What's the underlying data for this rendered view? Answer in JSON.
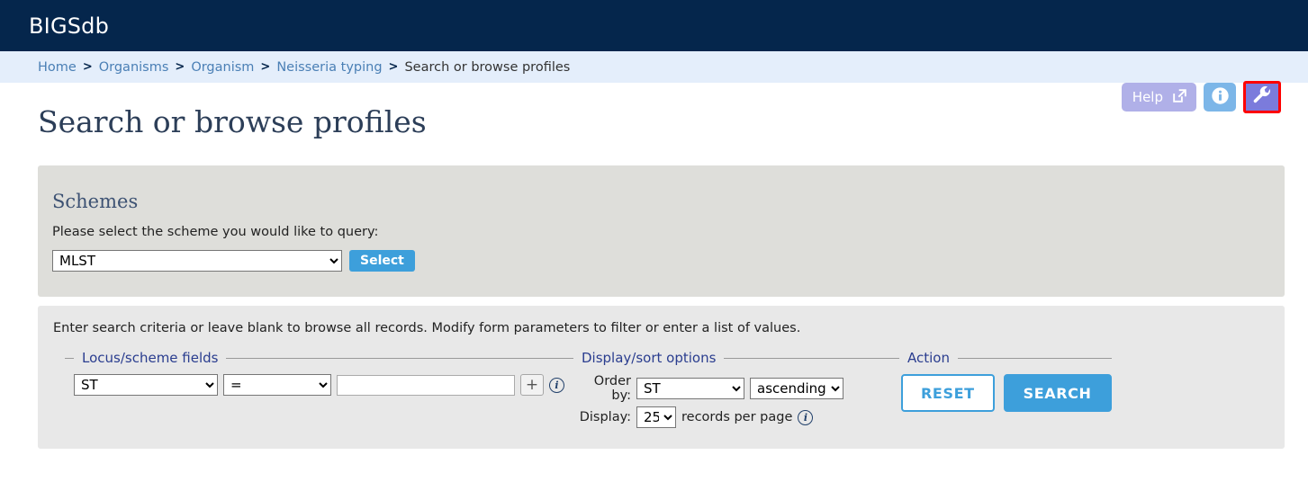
{
  "header": {
    "app_title": "BIGSdb"
  },
  "breadcrumb": {
    "items": [
      {
        "label": "Home",
        "current": false
      },
      {
        "label": "Organisms",
        "current": false
      },
      {
        "label": "Organism",
        "current": false
      },
      {
        "label": "Neisseria typing",
        "current": false
      },
      {
        "label": "Search or browse profiles",
        "current": true
      }
    ],
    "separator": ">"
  },
  "tools": {
    "help_label": "Help",
    "help_icon": "external-link-icon",
    "info_icon": "info-icon",
    "wrench_icon": "wrench-icon",
    "highlight_color": "#ff0000"
  },
  "page": {
    "title": "Search or browse profiles"
  },
  "schemes": {
    "heading": "Schemes",
    "prompt": "Please select the scheme you would like to query:",
    "selected_scheme": "MLST",
    "select_button": "Select"
  },
  "query": {
    "intro": "Enter search criteria or leave blank to browse all records. Modify form parameters to filter or enter a list of values.",
    "locus_fieldset": {
      "legend": "Locus/scheme fields",
      "field_value": "ST",
      "operator_value": "=",
      "search_value": "",
      "add_label": "+",
      "info_glyph": "i"
    },
    "display_fieldset": {
      "legend": "Display/sort options",
      "order_by_label": "Order by:",
      "order_by_value": "ST",
      "direction_value": "ascending",
      "display_label": "Display:",
      "page_size_value": "25",
      "records_text": "records per page",
      "info_glyph": "i"
    },
    "action_fieldset": {
      "legend": "Action",
      "reset_label": "RESET",
      "search_label": "SEARCH"
    }
  },
  "colors": {
    "header_navy": "#05264c",
    "breadcrumb_blue": "#e4eefb",
    "accent_blue": "#3d9fdb",
    "panel_tan": "#dededa",
    "panel_grey": "#e8e8e8"
  }
}
